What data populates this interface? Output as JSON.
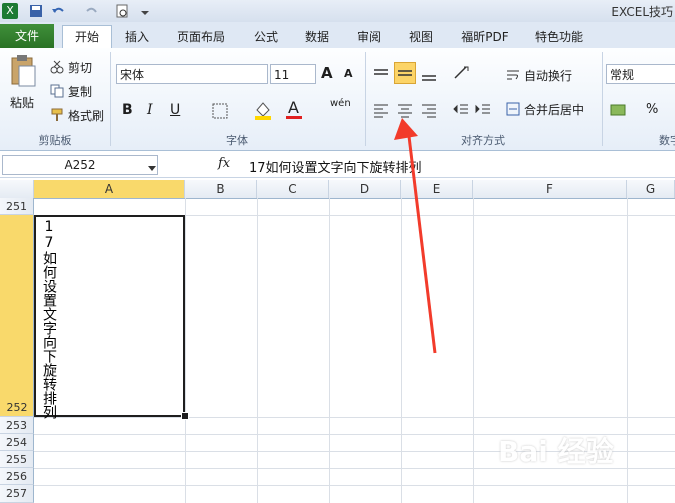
{
  "titlebar": {
    "title": "EXCEL技巧"
  },
  "tabs": [
    {
      "label": "文件"
    },
    {
      "label": "开始"
    },
    {
      "label": "插入"
    },
    {
      "label": "页面布局"
    },
    {
      "label": "公式"
    },
    {
      "label": "数据"
    },
    {
      "label": "审阅"
    },
    {
      "label": "视图"
    },
    {
      "label": "福昕PDF"
    },
    {
      "label": "特色功能"
    }
  ],
  "clipboard": {
    "paste": "粘贴",
    "cut": "剪切",
    "copy": "复制",
    "format_painter": "格式刷",
    "group": "剪贴板"
  },
  "font": {
    "name": "宋体",
    "size": "11",
    "bold": "B",
    "italic": "I",
    "underline": "U",
    "group": "字体",
    "grow": "A",
    "shrink": "A",
    "color_a": "A",
    "wen": "wén"
  },
  "alignment": {
    "wrap": "自动换行",
    "merge": "合并后居中",
    "group": "对齐方式"
  },
  "number": {
    "format": "常规",
    "percent": "%",
    "group": "数字"
  },
  "formula_bar": {
    "name_box": "A252",
    "fx": "fx",
    "content": "17如何设置文字向下旋转排列"
  },
  "columns": [
    "A",
    "B",
    "C",
    "D",
    "E",
    "F",
    "G"
  ],
  "rows": [
    "251",
    "252",
    "253",
    "254",
    "255",
    "256",
    "257"
  ],
  "cell": {
    "A252": "17如何设置文字向下旋转排列"
  },
  "watermark": "Bai 经验",
  "colors": {
    "file_tab": "#2a7225",
    "active_row_col": "#f9d96b",
    "arrow": "#f23b2b",
    "selected_button": "#fcd467"
  }
}
